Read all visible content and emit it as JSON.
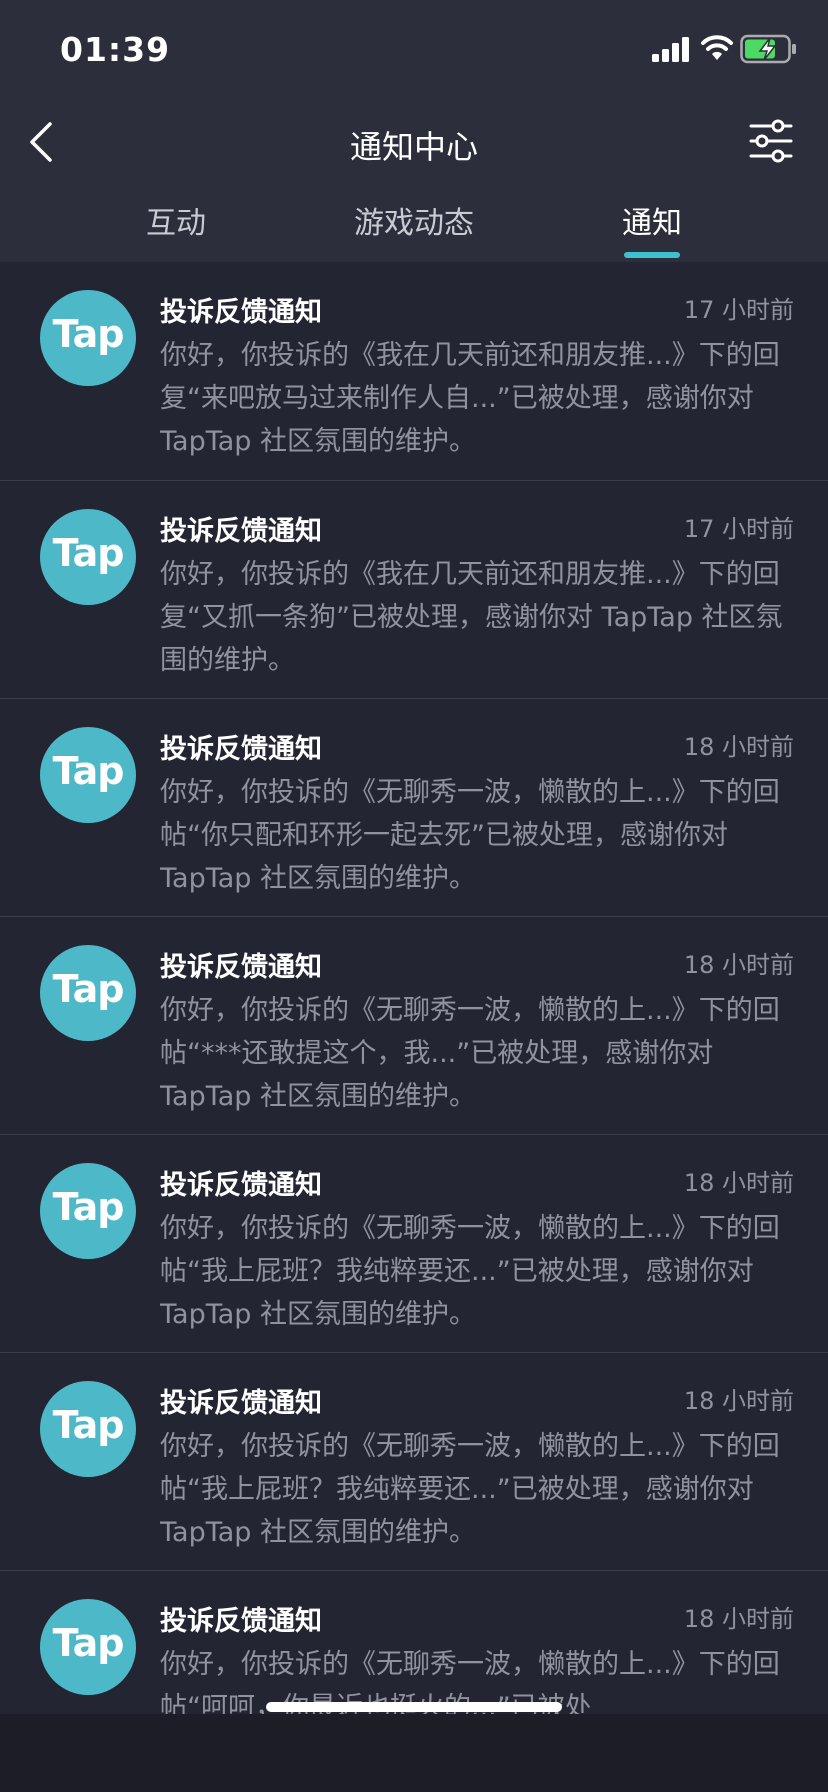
{
  "status_bar": {
    "time": "01:39"
  },
  "nav": {
    "title": "通知中心"
  },
  "tabs": [
    {
      "label": "互动",
      "active": false
    },
    {
      "label": "游戏动态",
      "active": false
    },
    {
      "label": "通知",
      "active": true
    }
  ],
  "colors": {
    "accent": "#3ec0d0",
    "avatar": "#4cb8c8",
    "background": "#232533"
  },
  "notifications": [
    {
      "avatar_text": "Tap",
      "title": "投诉反馈通知",
      "time": "17 小时前",
      "body": "你好，你投诉的《我在几天前还和朋友推...》下的回复“来吧放马过来制作人自...”已被处理，感谢你对 TapTap 社区氛围的维护。"
    },
    {
      "avatar_text": "Tap",
      "title": "投诉反馈通知",
      "time": "17 小时前",
      "body": "你好，你投诉的《我在几天前还和朋友推...》下的回复“又抓一条狗”已被处理，感谢你对 TapTap 社区氛围的维护。"
    },
    {
      "avatar_text": "Tap",
      "title": "投诉反馈通知",
      "time": "18 小时前",
      "body": "你好，你投诉的《无聊秀一波，懒散的上...》下的回帖“你只配和环形一起去死”已被处理，感谢你对 TapTap 社区氛围的维护。"
    },
    {
      "avatar_text": "Tap",
      "title": "投诉反馈通知",
      "time": "18 小时前",
      "body": "你好，你投诉的《无聊秀一波，懒散的上...》下的回帖“***还敢提这个，我...”已被处理，感谢你对 TapTap 社区氛围的维护。"
    },
    {
      "avatar_text": "Tap",
      "title": "投诉反馈通知",
      "time": "18 小时前",
      "body": "你好，你投诉的《无聊秀一波，懒散的上...》下的回帖“我上屁班？我纯粹要还...”已被处理，感谢你对 TapTap 社区氛围的维护。"
    },
    {
      "avatar_text": "Tap",
      "title": "投诉反馈通知",
      "time": "18 小时前",
      "body": "你好，你投诉的《无聊秀一波，懒散的上...》下的回帖“我上屁班？我纯粹要还...”已被处理，感谢你对 TapTap 社区氛围的维护。"
    },
    {
      "avatar_text": "Tap",
      "title": "投诉反馈通知",
      "time": "18 小时前",
      "body": "你好，你投诉的《无聊秀一波，懒散的上...》下的回帖“呵呵，你最近也挺火的...”已被处"
    }
  ]
}
